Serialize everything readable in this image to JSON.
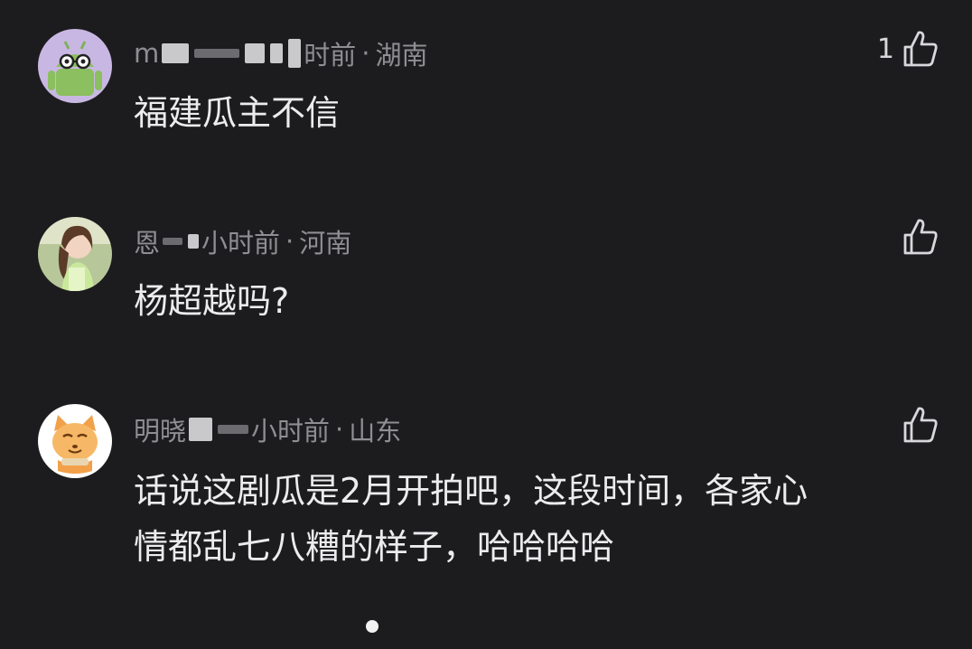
{
  "comments": [
    {
      "avatar_icon": "android-robot-glasses-icon",
      "name": "m",
      "time": "时前",
      "location": "湖南",
      "text_lines": [
        "福建瓜主不信"
      ],
      "likes": "1"
    },
    {
      "avatar_icon": "girl-photo-avatar",
      "name": "恩",
      "time": "小时前",
      "location": "河南",
      "text_lines": [
        "杨超越吗?"
      ],
      "likes": ""
    },
    {
      "avatar_icon": "cartoon-cat-avatar",
      "name": "明晓",
      "time": "小时前",
      "location": "山东",
      "text_lines": [
        "话说这剧瓜是2月开拍吧，这段时间，各家心",
        "情都乱七八糟的样子，哈哈哈哈"
      ],
      "likes": ""
    }
  ],
  "separator": "·",
  "colors": {
    "background": "#1c1c1e",
    "meta_text": "#8e8e93",
    "body_text": "#ececef",
    "like_icon": "#d8d8dc"
  }
}
